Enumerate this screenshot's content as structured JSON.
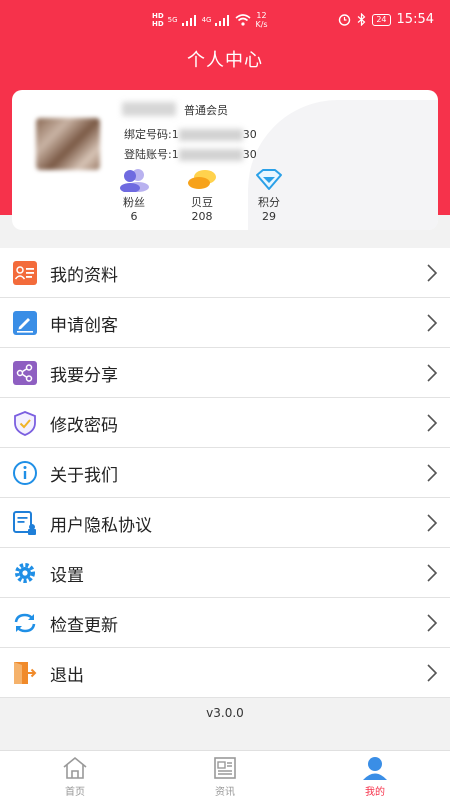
{
  "status_bar": {
    "hd1": "HD",
    "hd2": "HD",
    "net": "5G",
    "net2": "4G",
    "speed_value": "12",
    "speed_unit": "K/s",
    "battery": "24",
    "time": "15:54"
  },
  "header": {
    "title": "个人中心"
  },
  "profile": {
    "member_level": "普通会员",
    "bound_phone_label": "绑定号码:",
    "bound_phone_start": "1",
    "bound_phone_end": "30",
    "login_account_label": "登陆账号:",
    "login_account_start": "1",
    "login_account_end": "30",
    "stats": [
      {
        "label": "粉丝",
        "value": "6",
        "icon": "fans-icon"
      },
      {
        "label": "贝豆",
        "value": "208",
        "icon": "beans-icon"
      },
      {
        "label": "积分",
        "value": "29",
        "icon": "diamond-icon"
      }
    ]
  },
  "menu": [
    {
      "label": "我的资料",
      "icon": "profile-card-icon",
      "color": "#f36b3b"
    },
    {
      "label": "申请创客",
      "icon": "edit-icon",
      "color": "#3a8ee6"
    },
    {
      "label": "我要分享",
      "icon": "share-icon",
      "color": "#8e5fc1"
    },
    {
      "label": "修改密码",
      "icon": "shield-check-icon",
      "color": "#7b5fe0"
    },
    {
      "label": "关于我们",
      "icon": "info-icon",
      "color": "#1f8fe6"
    },
    {
      "label": "用户隐私协议",
      "icon": "privacy-doc-icon",
      "color": "#1f7fd8"
    },
    {
      "label": "设置",
      "icon": "gear-icon",
      "color": "#1f8fe6"
    },
    {
      "label": "检查更新",
      "icon": "refresh-icon",
      "color": "#1f8fe6"
    },
    {
      "label": "退出",
      "icon": "exit-icon",
      "color": "#f08a2a"
    }
  ],
  "version": "v3.0.0",
  "tabs": [
    {
      "label": "首页",
      "icon": "home-icon",
      "active": false
    },
    {
      "label": "资讯",
      "icon": "news-icon",
      "active": false
    },
    {
      "label": "我的",
      "icon": "user-icon",
      "active": true
    }
  ],
  "colors": {
    "brand": "#f6324b",
    "accent_blue": "#1f8fe6"
  }
}
